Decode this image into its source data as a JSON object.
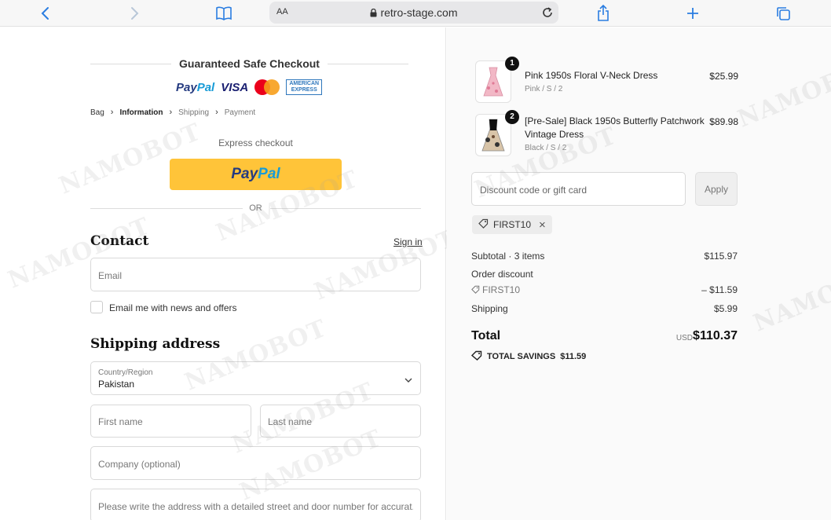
{
  "browser": {
    "aa_label": "AA",
    "url": "retro-stage.com",
    "icons": [
      "back-icon",
      "forward-icon",
      "bookmarks-icon",
      "lock-icon",
      "reload-icon",
      "share-icon",
      "new-tab-icon",
      "tabs-icon"
    ]
  },
  "checkout": {
    "guarantee_title": "Guaranteed Safe Checkout",
    "payment_logos": {
      "paypal": "PayPal",
      "visa": "VISA",
      "mastercard": "MasterCard",
      "amex": "AMERICAN EXPRESS"
    },
    "breadcrumbs": [
      "Bag",
      "Information",
      "Shipping",
      "Payment"
    ],
    "express_label": "Express checkout",
    "paypal_button": "PayPal",
    "or_label": "OR",
    "contact": {
      "heading": "Contact",
      "sign_in": "Sign in",
      "email_placeholder": "Email",
      "newsletter_label": "Email me with news and offers"
    },
    "shipping": {
      "heading": "Shipping address",
      "country_label": "Country/Region",
      "country_value": "Pakistan",
      "first_name_placeholder": "First name",
      "last_name_placeholder": "Last name",
      "company_placeholder": "Company (optional)",
      "address_placeholder": "Please write the address with a detailed street and door number for accurat..."
    }
  },
  "summary": {
    "items": [
      {
        "qty": "1",
        "title": "Pink 1950s Floral V-Neck Dress",
        "variant": "Pink / S / 2",
        "price": "$25.99"
      },
      {
        "qty": "2",
        "title": "[Pre-Sale] Black 1950s Butterfly Patchwork Vintage Dress",
        "variant": "Black / S / 2",
        "price": "$89.98"
      }
    ],
    "discount_placeholder": "Discount code or gift card",
    "apply_label": "Apply",
    "applied_code": "FIRST10",
    "subtotal_label": "Subtotal · 3 items",
    "subtotal_value": "$115.97",
    "order_discount_label": "Order discount",
    "discount_code_label": "FIRST10",
    "discount_value": "– $11.59",
    "shipping_label": "Shipping",
    "shipping_value": "$5.99",
    "total_label": "Total",
    "currency": "USD",
    "total_value": "$110.37",
    "savings_label": "TOTAL SAVINGS",
    "savings_value": "$11.59"
  },
  "watermark": "NAMOBOT",
  "colors": {
    "paypal_yellow": "#ffc439",
    "paypal_navy": "#253b80",
    "paypal_blue": "#179bd7",
    "ios_blue": "#2a7de1"
  }
}
